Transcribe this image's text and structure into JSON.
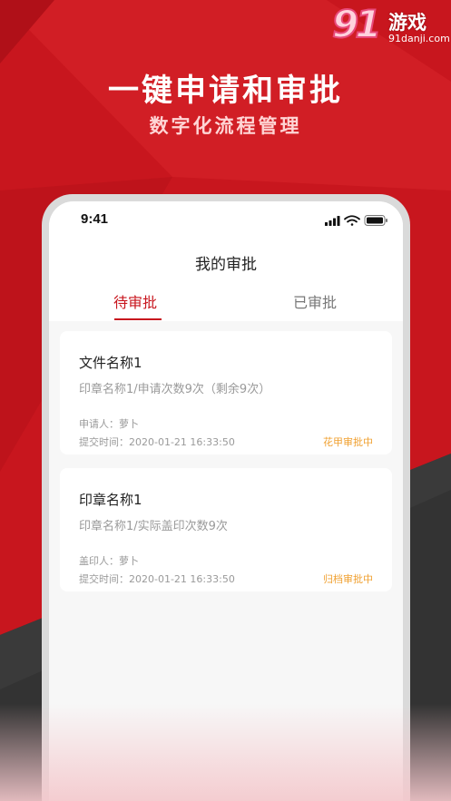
{
  "watermark": {
    "logo": "91",
    "name": "游戏",
    "url": "91danji.com"
  },
  "promo": {
    "headline": "一键申请和审批",
    "subheadline": "数字化流程管理"
  },
  "status_bar": {
    "time": "9:41"
  },
  "nav": {
    "title": "我的审批"
  },
  "tabs": [
    {
      "label": "待审批",
      "active": true
    },
    {
      "label": "已审批",
      "active": false
    }
  ],
  "approvals": [
    {
      "title": "文件名称1",
      "detail": "印章名称1/申请次数9次（剩余9次）",
      "person": "申请人：萝卜",
      "submit_time": "提交时间：2020-01-21  16:33:50",
      "status": "花甲审批中"
    },
    {
      "title": "印章名称1",
      "detail": "印章名称1/实际盖印次数9次",
      "person": "盖印人：萝卜",
      "submit_time": "提交时间：2020-01-21  16:33:50",
      "status": "归档审批中"
    }
  ],
  "colors": {
    "brand_red": "#c8161e",
    "status_orange": "#f0a030",
    "dark_panel": "#333333"
  }
}
